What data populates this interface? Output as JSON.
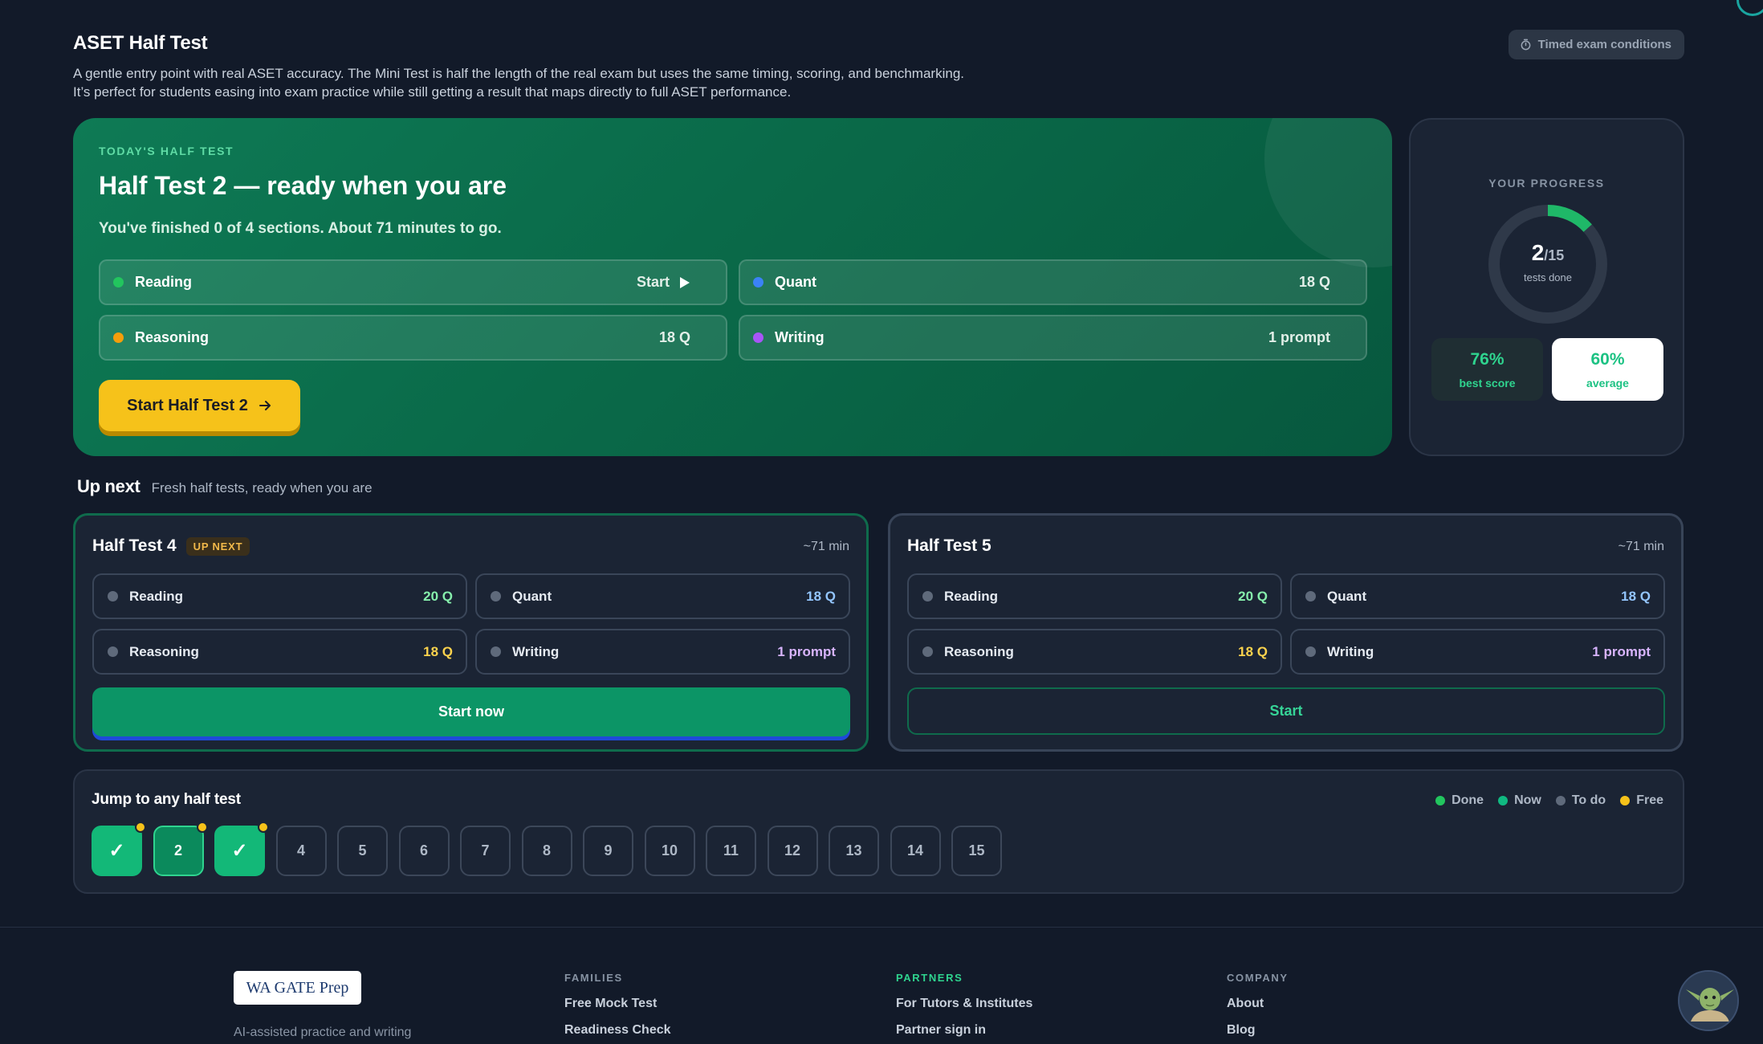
{
  "header": {
    "title": "ASET Half Test",
    "description_line1": "A gentle entry point with real ASET accuracy. The Mini Test is half the length of the real exam but uses the same timing, scoring, and benchmarking.",
    "description_line2": "It’s perfect for students easing into exam practice while still getting a result that maps directly to full ASET performance.",
    "timed_pill": "Timed exam conditions"
  },
  "hero": {
    "eyebrow": "TODAY'S HALF TEST",
    "title": "Half Test 2 — ready when you are",
    "subtitle": "You've finished 0 of 4 sections. About 71 minutes to go.",
    "sections": [
      {
        "name": "Reading",
        "meta": "Start",
        "color": "#22c55e"
      },
      {
        "name": "Quant",
        "meta": "18 Q",
        "color": "#3b82f6"
      },
      {
        "name": "Reasoning",
        "meta": "18 Q",
        "color": "#f59e0b"
      },
      {
        "name": "Writing",
        "meta": "1 prompt",
        "color": "#a855f7"
      }
    ],
    "cta": "Start Half Test 2"
  },
  "progress": {
    "label": "YOUR PROGRESS",
    "done": "2",
    "total": "/15",
    "ring_sub": "tests done",
    "fraction": 0.133,
    "best_value": "76%",
    "best_label": "best score",
    "avg_value": "60%",
    "avg_label": "average"
  },
  "upnext": {
    "title": "Up next",
    "subtitle": "Fresh half tests, ready when you are",
    "cards": [
      {
        "name": "Half Test 4",
        "badge": "UP NEXT",
        "duration": "~71 min",
        "sections": [
          {
            "name": "Reading",
            "q": "20 Q",
            "qcolor": "#86efac"
          },
          {
            "name": "Quant",
            "q": "18 Q",
            "qcolor": "#93c5fd"
          },
          {
            "name": "Reasoning",
            "q": "18 Q",
            "qcolor": "#fcd34d"
          },
          {
            "name": "Writing",
            "q": "1 prompt",
            "qcolor": "#d8b4fe"
          }
        ],
        "button": "Start now"
      },
      {
        "name": "Half Test 5",
        "duration": "~71 min",
        "sections": [
          {
            "name": "Reading",
            "q": "20 Q",
            "qcolor": "#86efac"
          },
          {
            "name": "Quant",
            "q": "18 Q",
            "qcolor": "#93c5fd"
          },
          {
            "name": "Reasoning",
            "q": "18 Q",
            "qcolor": "#fcd34d"
          },
          {
            "name": "Writing",
            "q": "1 prompt",
            "qcolor": "#d8b4fe"
          }
        ],
        "button": "Start"
      }
    ]
  },
  "jump": {
    "title": "Jump to any half test",
    "legend": [
      {
        "label": "Done",
        "color": "#22c55e"
      },
      {
        "label": "Now",
        "color": "#10b981"
      },
      {
        "label": "To do",
        "color": "#5f6a7b"
      },
      {
        "label": "Free",
        "color": "#f6c21a"
      }
    ],
    "tiles": [
      {
        "label": "✓",
        "state": "done",
        "free": true
      },
      {
        "label": "2",
        "state": "now",
        "free": true
      },
      {
        "label": "✓",
        "state": "done",
        "free": true
      },
      {
        "label": "4",
        "state": "todo"
      },
      {
        "label": "5",
        "state": "todo"
      },
      {
        "label": "6",
        "state": "todo"
      },
      {
        "label": "7",
        "state": "todo"
      },
      {
        "label": "8",
        "state": "todo"
      },
      {
        "label": "9",
        "state": "todo"
      },
      {
        "label": "10",
        "state": "todo"
      },
      {
        "label": "11",
        "state": "todo"
      },
      {
        "label": "12",
        "state": "todo"
      },
      {
        "label": "13",
        "state": "todo"
      },
      {
        "label": "14",
        "state": "todo"
      },
      {
        "label": "15",
        "state": "todo"
      }
    ]
  },
  "footer": {
    "logo": "WA GATE Prep",
    "tagline": "AI-assisted practice and writing",
    "columns": [
      {
        "heading": "FAMILIES",
        "links": [
          "Free Mock Test",
          "Readiness Check"
        ]
      },
      {
        "heading": "PARTNERS",
        "links": [
          "For Tutors & Institutes",
          "Partner sign in"
        ]
      },
      {
        "heading": "COMPANY",
        "links": [
          "About",
          "Blog"
        ]
      }
    ]
  }
}
